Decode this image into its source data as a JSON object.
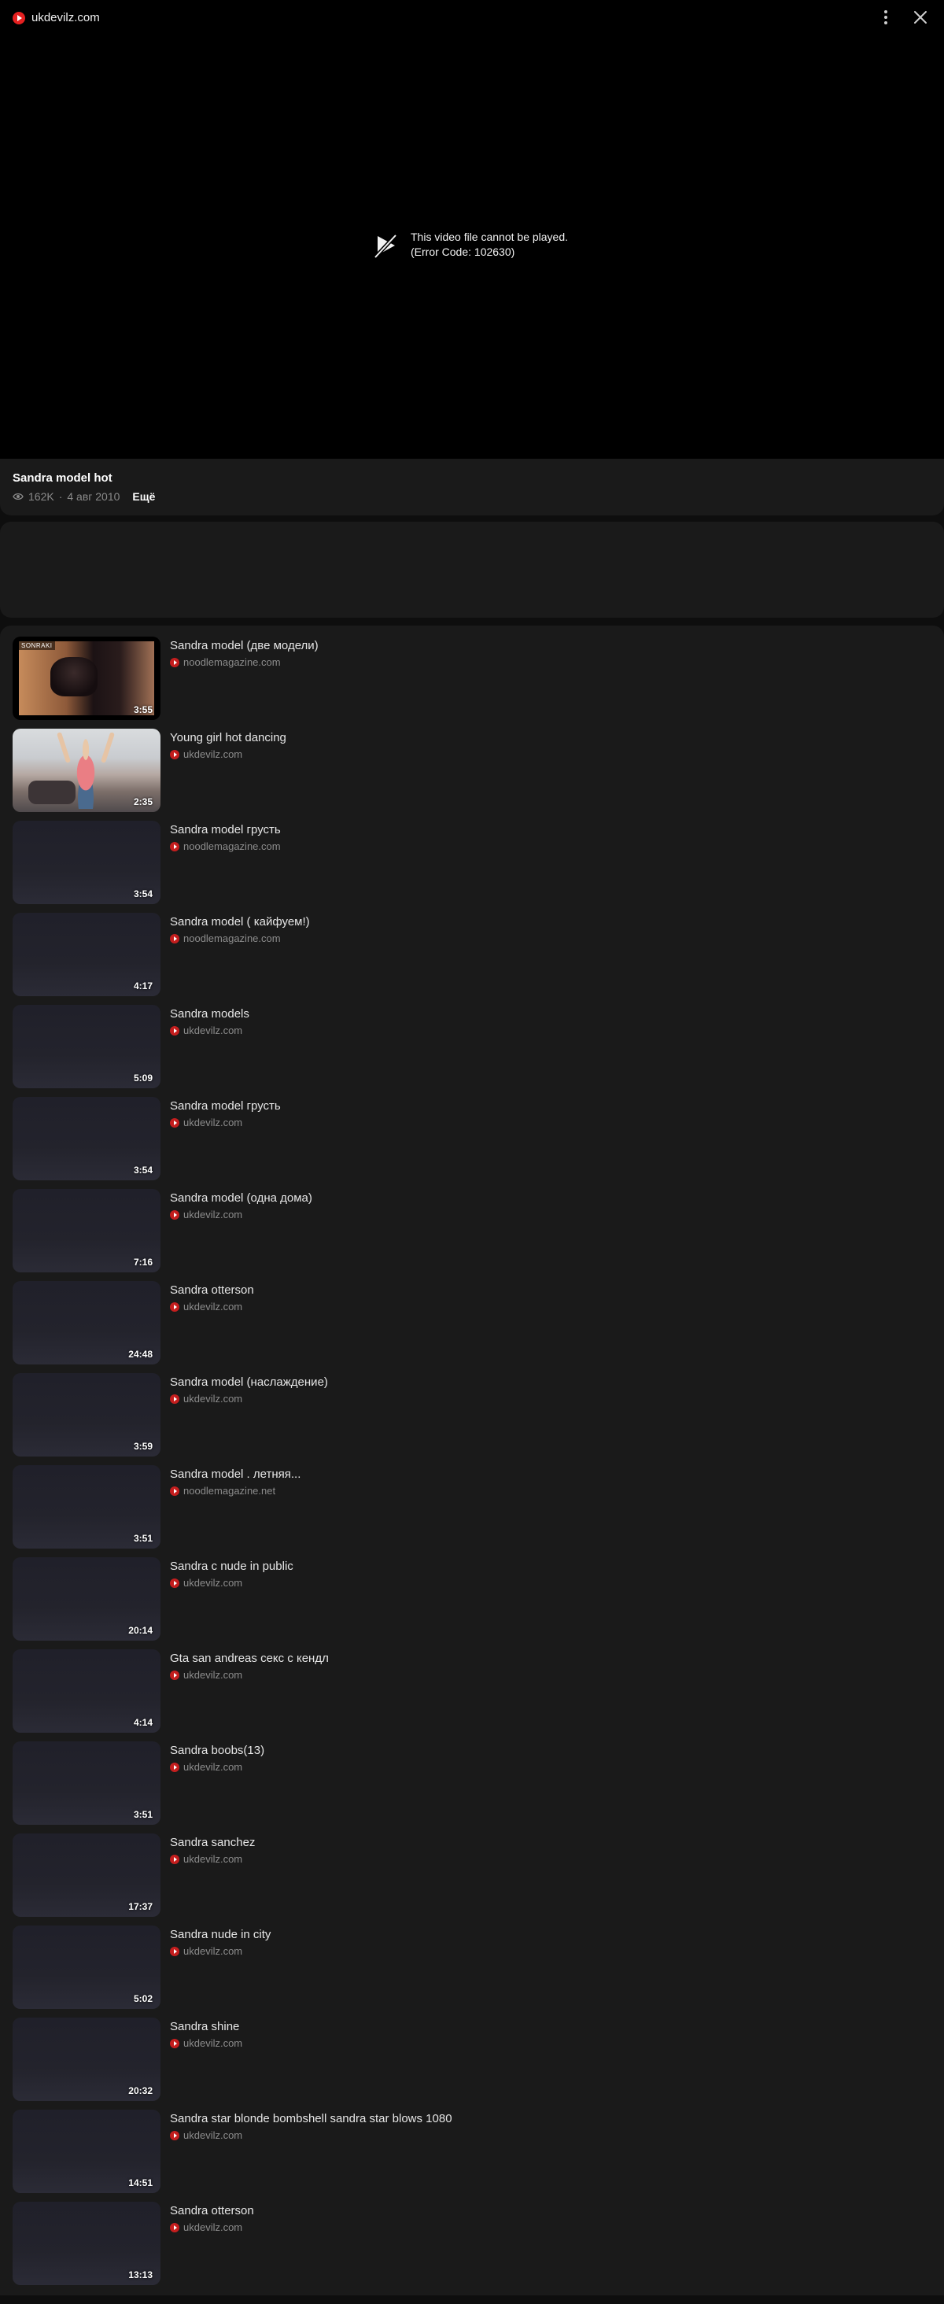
{
  "header": {
    "site_name": "ukdevilz.com",
    "icons": [
      "play-logo-icon",
      "more-vertical-icon",
      "close-icon"
    ]
  },
  "player": {
    "error_line1": "This video file cannot be played.",
    "error_line2": "(Error Code: 102630)",
    "error_icon": "broken-play-icon"
  },
  "video": {
    "title": "Sandra model hot",
    "views": "162K",
    "separator": "·",
    "date": "4 авг 2010",
    "more_label": "Ещё"
  },
  "colors": {
    "background": "#0e0e0e",
    "card": "#1a1a1a",
    "source_icon": "#c41e1e"
  },
  "related": [
    {
      "title": "Sandra model (две модели)",
      "source": "noodlemagazine.com",
      "duration": "3:55",
      "thumb_tag": "SONRAKI"
    },
    {
      "title": "Young girl hot dancing",
      "source": "ukdevilz.com",
      "duration": "2:35"
    },
    {
      "title": "Sandra model грусть",
      "source": "noodlemagazine.com",
      "duration": "3:54"
    },
    {
      "title": "Sandra model ( кайфуем!)",
      "source": "noodlemagazine.com",
      "duration": "4:17"
    },
    {
      "title": "Sandra models",
      "source": "ukdevilz.com",
      "duration": "5:09"
    },
    {
      "title": "Sandra model грусть",
      "source": "ukdevilz.com",
      "duration": "3:54"
    },
    {
      "title": "Sandra model (одна дома)",
      "source": "ukdevilz.com",
      "duration": "7:16"
    },
    {
      "title": "Sandra otterson",
      "source": "ukdevilz.com",
      "duration": "24:48"
    },
    {
      "title": "Sandra model (наслаждение)",
      "source": "ukdevilz.com",
      "duration": "3:59"
    },
    {
      "title": "Sandra model . летняя...",
      "source": "noodlemagazine.net",
      "duration": "3:51"
    },
    {
      "title": "Sandra c nude in public",
      "source": "ukdevilz.com",
      "duration": "20:14"
    },
    {
      "title": "Gta san andreas секс с кендл",
      "source": "ukdevilz.com",
      "duration": "4:14"
    },
    {
      "title": "Sandra boobs(13)",
      "source": "ukdevilz.com",
      "duration": "3:51"
    },
    {
      "title": "Sandra sanchez",
      "source": "ukdevilz.com",
      "duration": "17:37"
    },
    {
      "title": "Sandra nude in city",
      "source": "ukdevilz.com",
      "duration": "5:02"
    },
    {
      "title": "Sandra shine",
      "source": "ukdevilz.com",
      "duration": "20:32"
    },
    {
      "title": "Sandra star blonde bombshell sandra star blows 1080",
      "source": "ukdevilz.com",
      "duration": "14:51"
    },
    {
      "title": "Sandra otterson",
      "source": "ukdevilz.com",
      "duration": "13:13"
    }
  ]
}
